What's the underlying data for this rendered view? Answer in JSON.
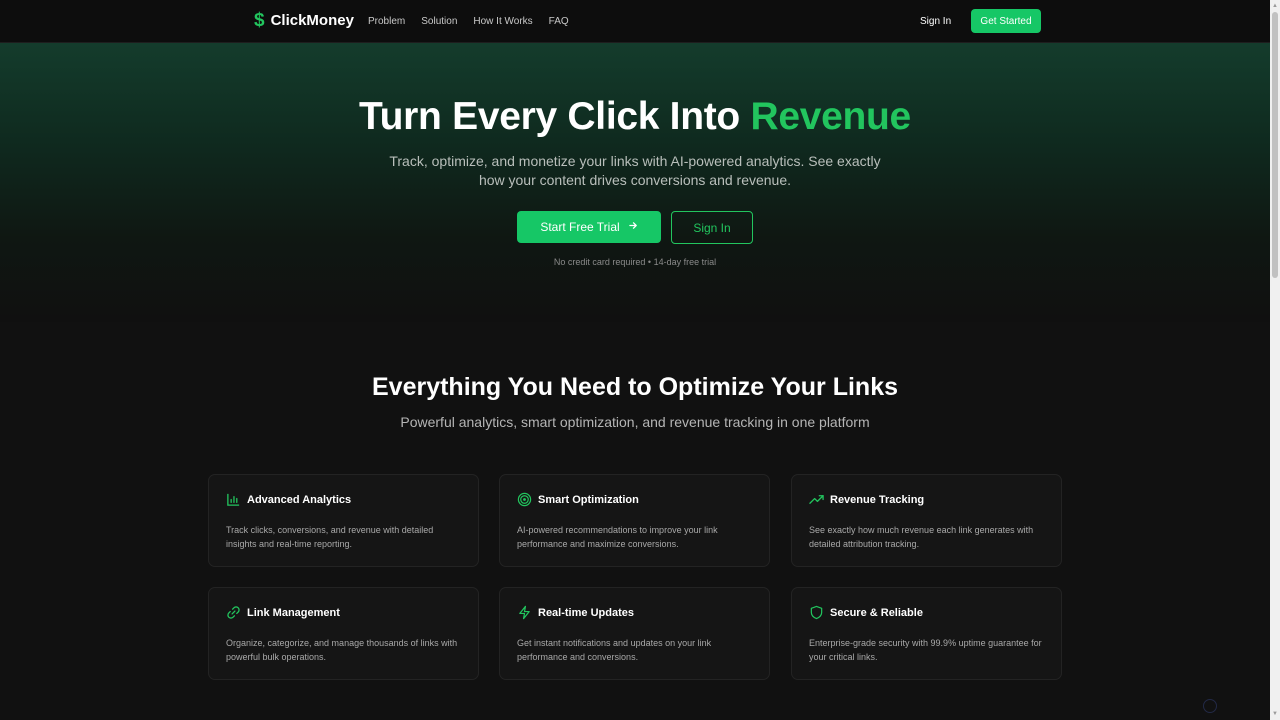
{
  "brand": {
    "symbol": "$",
    "name": "ClickMoney"
  },
  "nav": {
    "links": [
      "Problem",
      "Solution",
      "How It Works",
      "FAQ"
    ],
    "signin": "Sign In",
    "get_started": "Get Started"
  },
  "hero": {
    "title_main": "Turn Every Click Into ",
    "title_accent": "Revenue",
    "subtitle": "Track, optimize, and monetize your links with AI-powered analytics. See exactly how your content drives conversions and revenue.",
    "cta_primary": "Start Free Trial",
    "cta_secondary": "Sign In",
    "note": "No credit card required • 14-day free trial"
  },
  "features": {
    "title": "Everything You Need to Optimize Your Links",
    "subtitle": "Powerful analytics, smart optimization, and revenue tracking in one platform",
    "cards": [
      {
        "icon": "bar-chart-icon",
        "title": "Advanced Analytics",
        "desc": "Track clicks, conversions, and revenue with detailed insights and real-time reporting."
      },
      {
        "icon": "target-icon",
        "title": "Smart Optimization",
        "desc": "AI-powered recommendations to improve your link performance and maximize conversions."
      },
      {
        "icon": "trending-up-icon",
        "title": "Revenue Tracking",
        "desc": "See exactly how much revenue each link generates with detailed attribution tracking."
      },
      {
        "icon": "link-icon",
        "title": "Link Management",
        "desc": "Organize, categorize, and manage thousands of links with powerful bulk operations."
      },
      {
        "icon": "lightning-icon",
        "title": "Real-time Updates",
        "desc": "Get instant notifications and updates on your link performance and conversions."
      },
      {
        "icon": "shield-icon",
        "title": "Secure & Reliable",
        "desc": "Enterprise-grade security with 99.9% uptime guarantee for your critical links."
      }
    ]
  },
  "colors": {
    "accent": "#22c55e",
    "background": "#111111",
    "card": "#151515"
  }
}
